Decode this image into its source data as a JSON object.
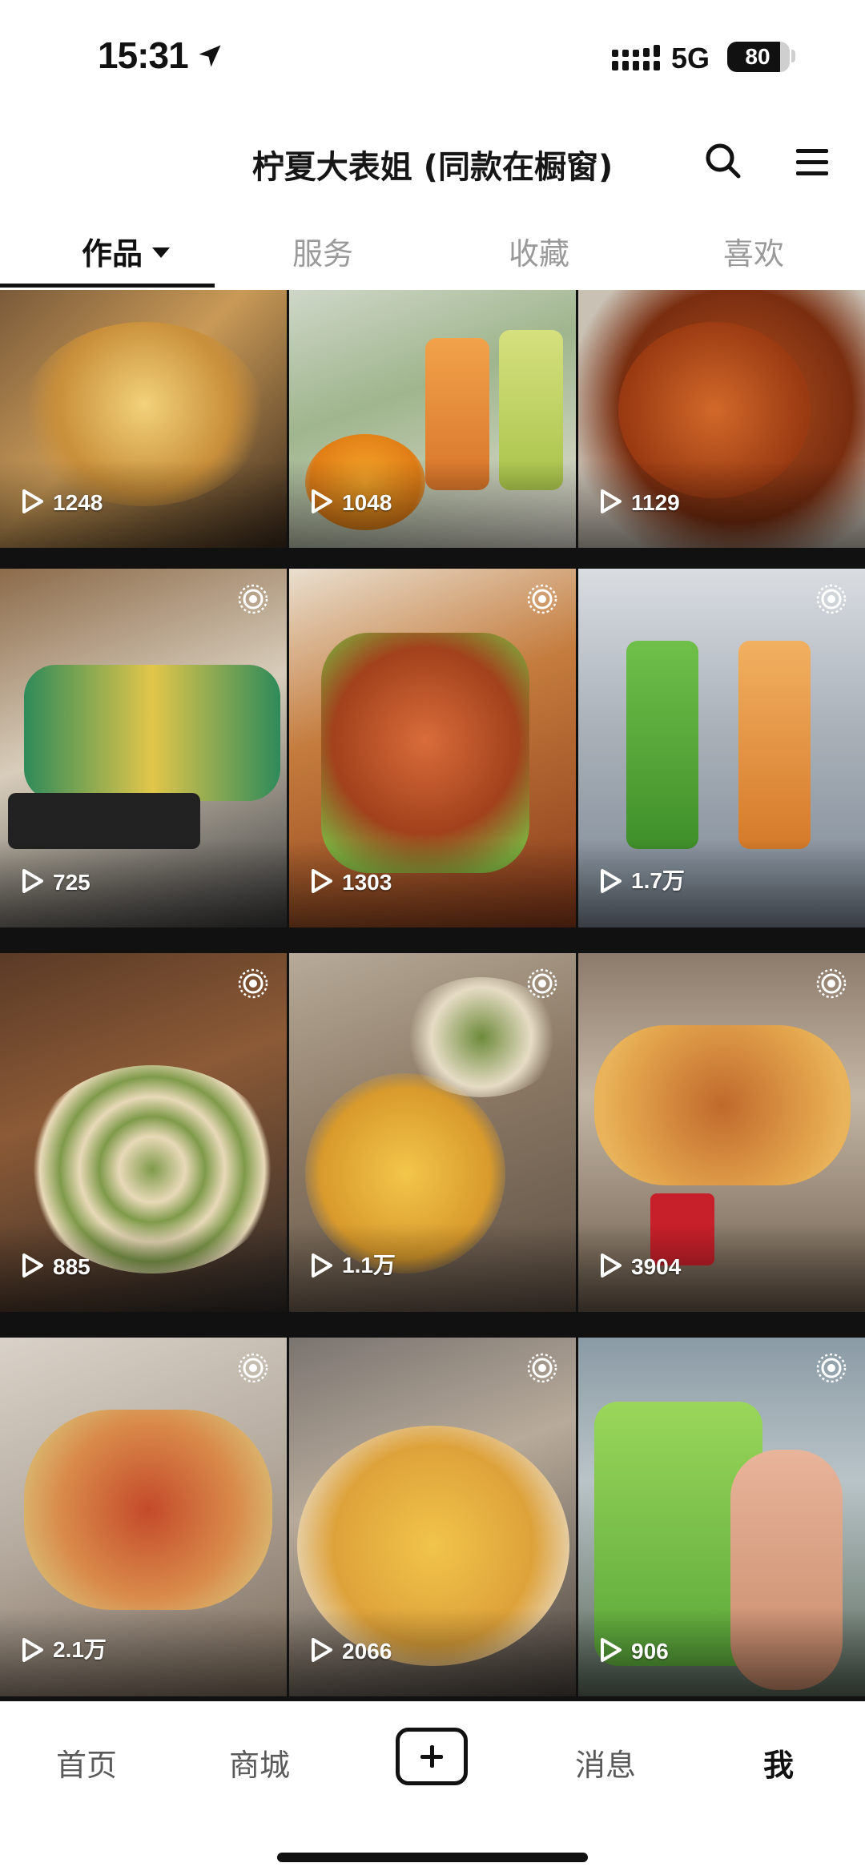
{
  "status_bar": {
    "time": "15:31",
    "network": "5G",
    "battery": "80"
  },
  "header": {
    "title": "柠夏大表姐 (同款在橱窗)"
  },
  "tabs": [
    {
      "label": "作品",
      "active": true
    },
    {
      "label": "服务",
      "active": false
    },
    {
      "label": "收藏",
      "active": false
    },
    {
      "label": "喜欢",
      "active": false
    }
  ],
  "videos": [
    {
      "views": "1248",
      "live": false
    },
    {
      "views": "1048",
      "live": false
    },
    {
      "views": "1129",
      "live": false
    },
    {
      "views": "725",
      "live": true
    },
    {
      "views": "1303",
      "live": true
    },
    {
      "views": "1.7万",
      "live": true
    },
    {
      "views": "885",
      "live": true
    },
    {
      "views": "1.1万",
      "live": true
    },
    {
      "views": "3904",
      "live": true
    },
    {
      "views": "2.1万",
      "live": true
    },
    {
      "views": "2066",
      "live": true
    },
    {
      "views": "906",
      "live": true
    }
  ],
  "bottom_nav": [
    {
      "label": "首页",
      "active": false
    },
    {
      "label": "商城",
      "active": false
    },
    {
      "label": "消息",
      "active": false
    },
    {
      "label": "我",
      "active": true
    }
  ],
  "icons": {
    "location": "location-arrow-icon",
    "signal": "cellular-signal-icon",
    "search": "search-icon",
    "menu": "hamburger-menu-icon",
    "play": "play-icon",
    "live_photo": "live-photo-icon",
    "create": "plus-icon"
  }
}
